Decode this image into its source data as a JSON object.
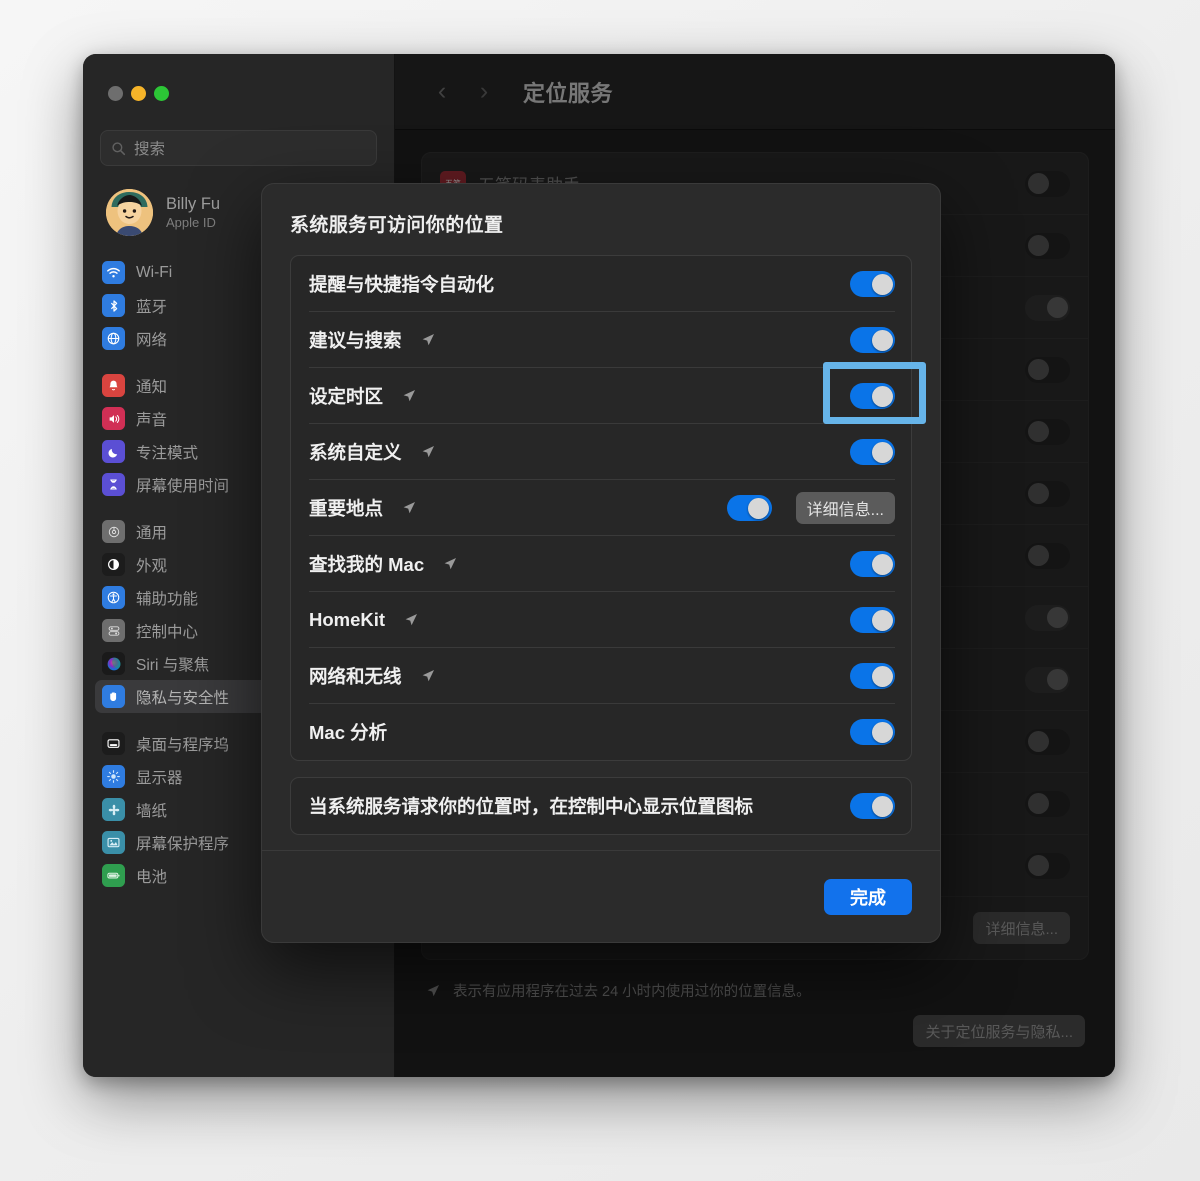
{
  "window": {
    "traffic_lights": [
      "close",
      "minimize",
      "maximize"
    ],
    "colors": {
      "close": "#6e6e6e",
      "minimize": "#f6b429",
      "maximize": "#2cc636",
      "accent_blue": "#1272ec",
      "toggle_on": "#0a74e8",
      "highlight": "#66b4e9"
    }
  },
  "sidebar": {
    "search": {
      "placeholder": "搜索",
      "value": "",
      "icon": "search-icon"
    },
    "account": {
      "name": "Billy Fu",
      "subtitle": "Apple ID",
      "avatar": "user-avatar"
    },
    "groups": [
      {
        "items": [
          {
            "label": "Wi-Fi",
            "icon": "wifi-icon",
            "color": "#2f7ce0",
            "selected": false
          },
          {
            "label": "蓝牙",
            "icon": "bluetooth-icon",
            "color": "#2f7ce0",
            "selected": false
          },
          {
            "label": "网络",
            "icon": "globe-icon",
            "color": "#2f7ce0",
            "selected": false
          }
        ]
      },
      {
        "items": [
          {
            "label": "通知",
            "icon": "bell-icon",
            "color": "#d9443f",
            "selected": false
          },
          {
            "label": "声音",
            "icon": "speaker-icon",
            "color": "#d12f55",
            "selected": false
          },
          {
            "label": "专注模式",
            "icon": "moon-icon",
            "color": "#5b4fd4",
            "selected": false
          },
          {
            "label": "屏幕使用时间",
            "icon": "hourglass-icon",
            "color": "#5b4fd4",
            "selected": false
          }
        ]
      },
      {
        "items": [
          {
            "label": "通用",
            "icon": "gear-icon",
            "color": "#6e6e6e",
            "selected": false
          },
          {
            "label": "外观",
            "icon": "appearance-icon",
            "color": "#1c1c1c",
            "selected": false
          },
          {
            "label": "辅助功能",
            "icon": "accessibility-icon",
            "color": "#2f7ce0",
            "selected": false
          },
          {
            "label": "控制中心",
            "icon": "control-center-icon",
            "color": "#6e6e6e",
            "selected": false
          },
          {
            "label": "Siri 与聚焦",
            "icon": "siri-icon",
            "color": "#8a2b6b",
            "selected": false
          },
          {
            "label": "隐私与安全性",
            "icon": "hand-icon",
            "color": "#2f7ce0",
            "selected": true
          }
        ]
      },
      {
        "items": [
          {
            "label": "桌面与程序坞",
            "icon": "desktop-dock-icon",
            "color": "#1c1c1c",
            "selected": false
          },
          {
            "label": "显示器",
            "icon": "display-icon",
            "color": "#2f7ce0",
            "selected": false
          },
          {
            "label": "墙纸",
            "icon": "wallpaper-icon",
            "color": "#3a8fa8",
            "selected": false
          },
          {
            "label": "屏幕保护程序",
            "icon": "screensaver-icon",
            "color": "#3a8fa8",
            "selected": false
          },
          {
            "label": "电池",
            "icon": "battery-icon",
            "color": "#2f9e4f",
            "selected": false
          }
        ]
      }
    ]
  },
  "toolbar": {
    "back_icon": "chevron-left-icon",
    "forward_icon": "chevron-right-icon",
    "title": "定位服务"
  },
  "background_pane": {
    "first_app": {
      "label": "五笔码表助手",
      "icon": "wubi-app-icon",
      "icon_text": "五笔",
      "toggle": "off"
    },
    "hidden_rows": [
      {
        "toggle": "off"
      },
      {
        "toggle": "off"
      },
      {
        "toggle": "on"
      },
      {
        "toggle": "off"
      },
      {
        "toggle": "off"
      },
      {
        "toggle": "off"
      },
      {
        "toggle": "off"
      },
      {
        "toggle": "on"
      },
      {
        "toggle": "on"
      },
      {
        "toggle": "off"
      },
      {
        "toggle": "off"
      },
      {
        "toggle": "off"
      }
    ],
    "details_button": "详细信息...",
    "footnote": {
      "icon": "location-arrow-icon",
      "text": "表示有应用程序在过去 24 小时内使用过你的位置信息。"
    },
    "privacy_button": "关于定位服务与隐私..."
  },
  "dialog": {
    "title": "系统服务可访问你的位置",
    "services": [
      {
        "label": "提醒与快捷指令自动化",
        "arrow": false,
        "toggle": "on",
        "button": null
      },
      {
        "label": "建议与搜索",
        "arrow": true,
        "toggle": "on",
        "button": null
      },
      {
        "label": "设定时区",
        "arrow": true,
        "toggle": "on",
        "button": null,
        "highlighted": true
      },
      {
        "label": "系统自定义",
        "arrow": true,
        "toggle": "on",
        "button": null
      },
      {
        "label": "重要地点",
        "arrow": true,
        "toggle": "on",
        "button": "详细信息..."
      },
      {
        "label": "查找我的 Mac",
        "arrow": true,
        "toggle": "on",
        "button": null
      },
      {
        "label": "HomeKit",
        "arrow": true,
        "toggle": "on",
        "button": null
      },
      {
        "label": "网络和无线",
        "arrow": true,
        "toggle": "on",
        "button": null
      },
      {
        "label": "Mac 分析",
        "arrow": false,
        "toggle": "on",
        "button": null
      }
    ],
    "control_center_option": {
      "label": "当系统服务请求你的位置时，在控制中心显示位置图标",
      "toggle": "on"
    },
    "done_button": "完成"
  }
}
